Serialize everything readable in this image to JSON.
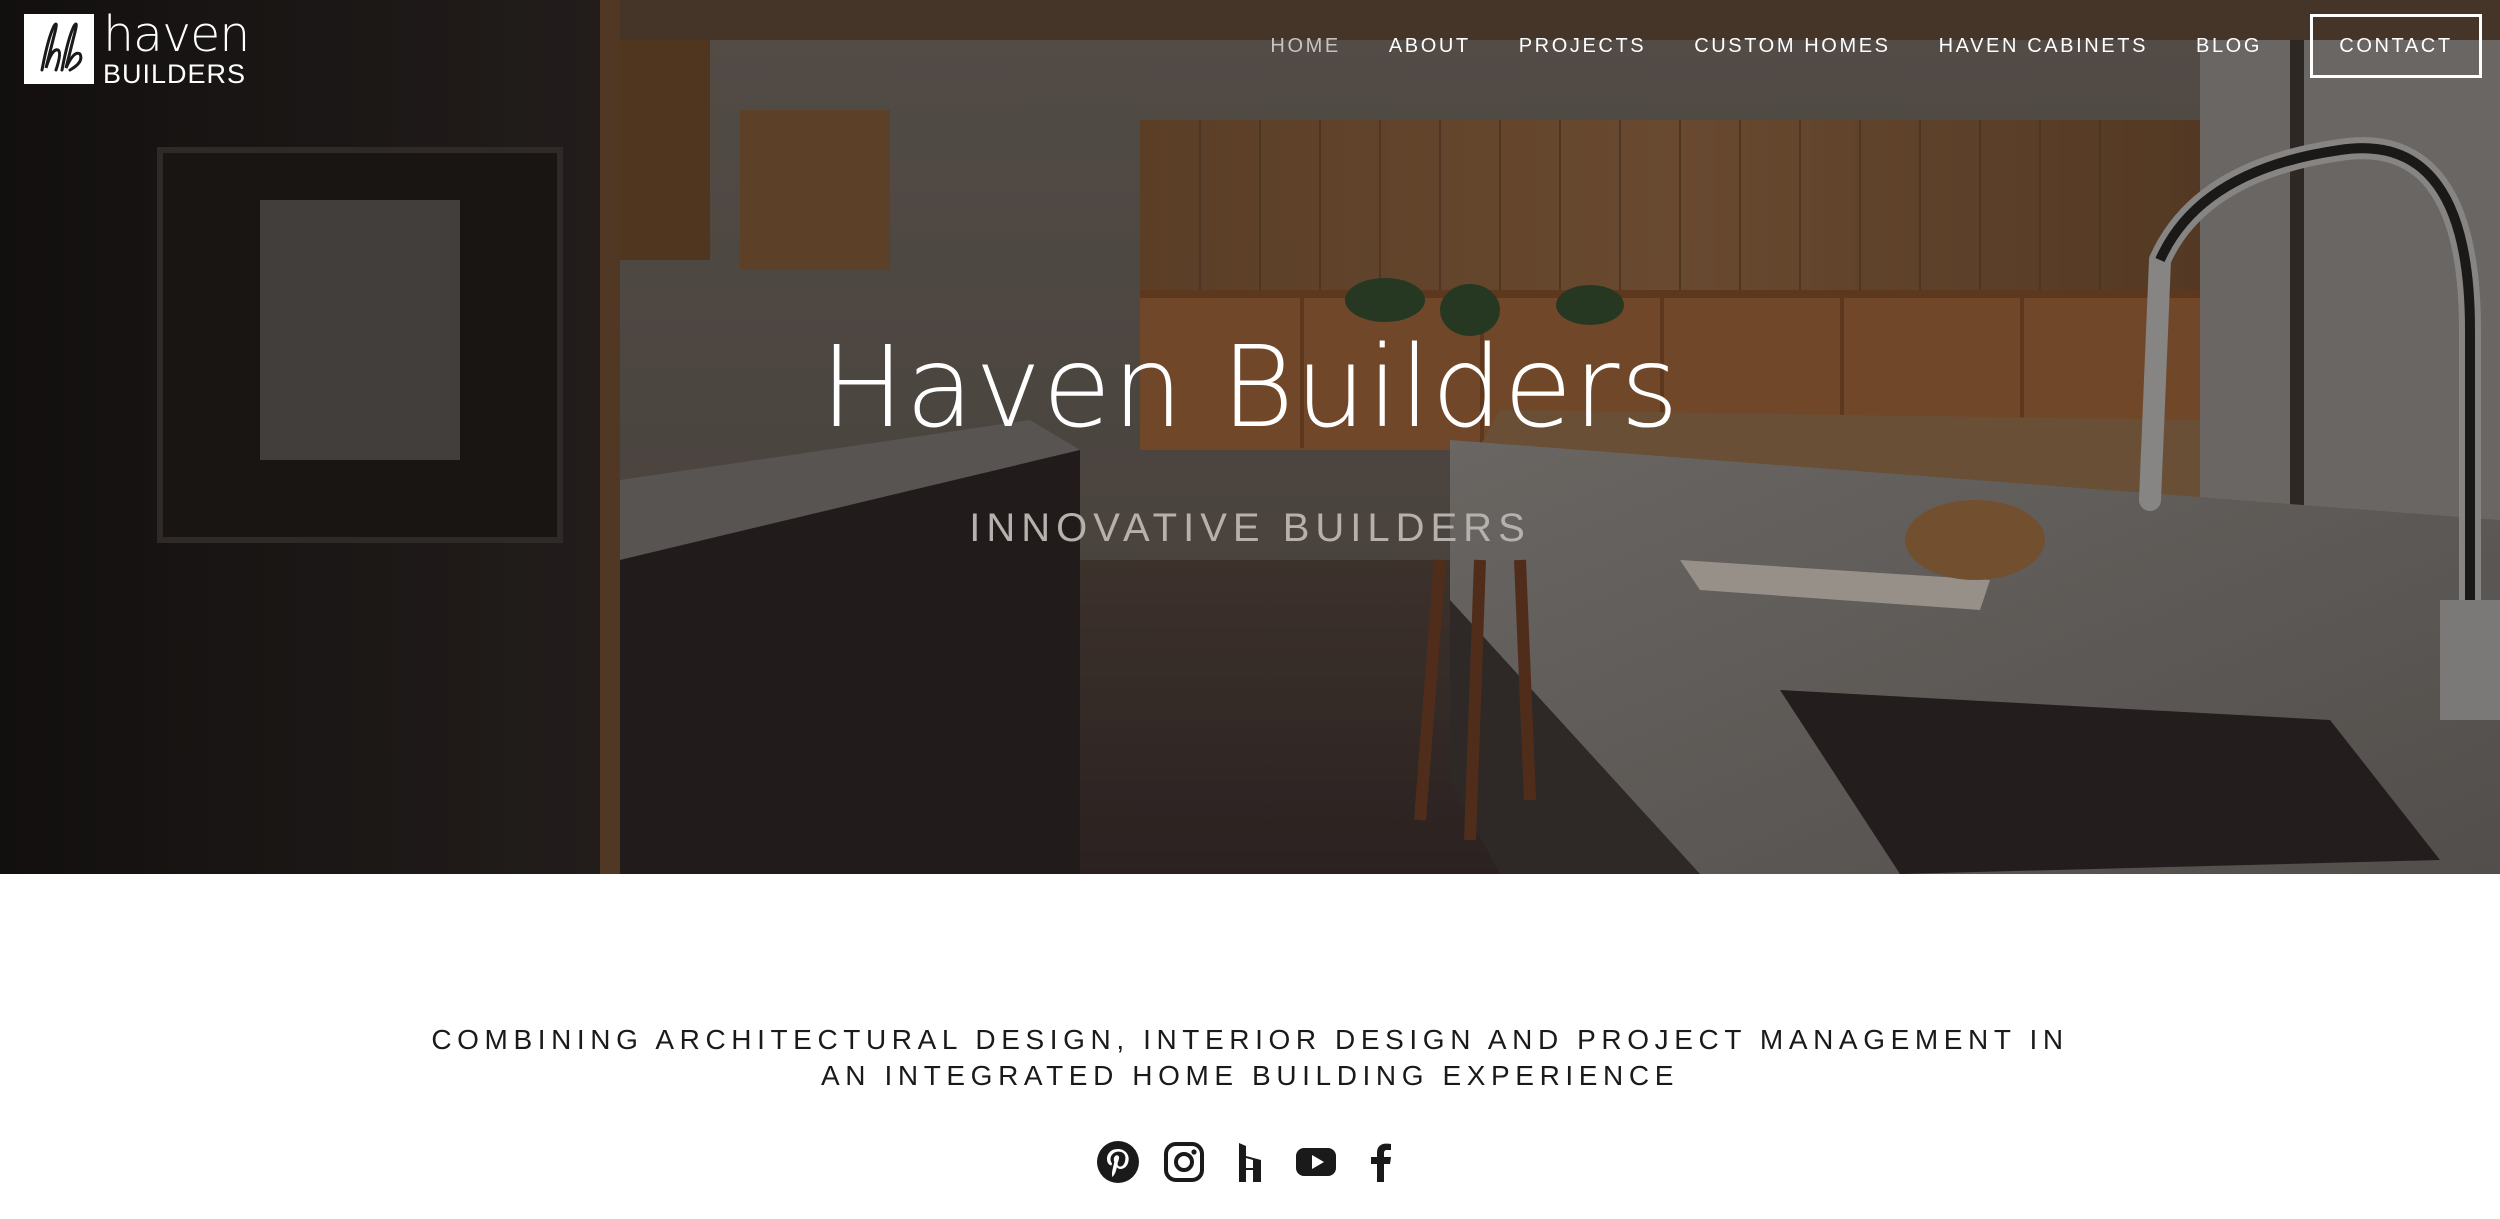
{
  "brand": {
    "word": "haven",
    "sub": "BUILDERS",
    "monogram": "hb"
  },
  "nav": {
    "items": [
      {
        "label": "HOME",
        "active": true
      },
      {
        "label": "ABOUT",
        "active": false
      },
      {
        "label": "PROJECTS",
        "active": false
      },
      {
        "label": "CUSTOM HOMES",
        "active": false
      },
      {
        "label": "HAVEN CABINETS",
        "active": false
      },
      {
        "label": "BLOG",
        "active": false
      }
    ],
    "contact_label": "CONTACT"
  },
  "hero": {
    "title": "Haven Builders",
    "subtitle": "INNOVATIVE BUILDERS"
  },
  "tagline": {
    "line1": "COMBINING ARCHITECTURAL DESIGN, INTERIOR DESIGN AND PROJECT MANAGEMENT IN",
    "line2": "AN INTEGRATED HOME BUILDING EXPERIENCE"
  },
  "social": [
    {
      "name": "pinterest-icon"
    },
    {
      "name": "instagram-icon"
    },
    {
      "name": "houzz-icon"
    },
    {
      "name": "youtube-icon"
    },
    {
      "name": "facebook-icon"
    }
  ],
  "colors": {
    "text_dark": "#1a1a1a",
    "nav_active": "#c8c3c0",
    "subtitle": "#b7b1ad"
  }
}
